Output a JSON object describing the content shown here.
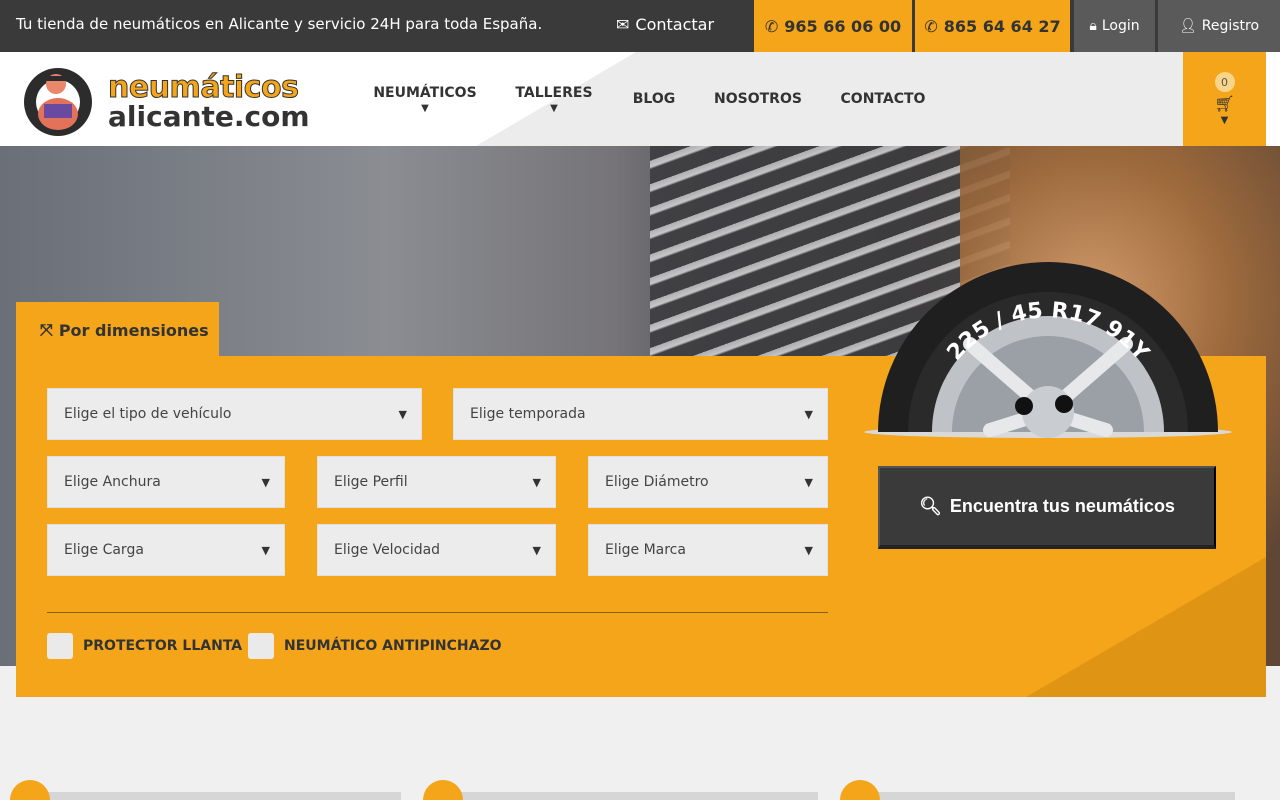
{
  "topbar": {
    "tagline": "Tu tienda de neumáticos en Alicante y servicio 24H para toda España.",
    "contact_label": "Contactar",
    "phone1": "965 66 06 00",
    "phone2": "865 64 64 27",
    "login_label": "Login",
    "register_label": "Registro"
  },
  "logo": {
    "line1": "neumáticos",
    "line2": "alicante.com"
  },
  "nav": {
    "items": [
      {
        "label": "NEUMÁTICOS"
      },
      {
        "label": "TALLERES"
      },
      {
        "label": "BLOG"
      },
      {
        "label": "NOSOTROS"
      },
      {
        "label": "CONTACTO"
      }
    ]
  },
  "cart": {
    "count": "0"
  },
  "search": {
    "tab_label": "Por dimensiones",
    "vehicle_type": "Elige el tipo de vehículo",
    "season": "Elige temporada",
    "width": "Elige Anchura",
    "profile": "Elige Perfil",
    "diameter": "Elige Diámetro",
    "load": "Elige Carga",
    "speed": "Elige Velocidad",
    "brand": "Elige Marca",
    "rim_protector": "PROTECTOR LLANTA",
    "run_flat": "NEUMÁTICO ANTIPINCHAZO",
    "tire_size": "225 / 45 R17 91Y",
    "submit_label": "Encuentra tus neumáticos"
  },
  "colors": {
    "accent": "#f4a51a",
    "dark": "#3a3a3a"
  },
  "icons": {
    "envelope": "envelope-icon",
    "phone": "phone-icon",
    "lock": "lock-icon",
    "user_plus": "user-plus-icon",
    "cart": "cart-icon",
    "expand": "expand-icon",
    "search": "search-icon"
  }
}
